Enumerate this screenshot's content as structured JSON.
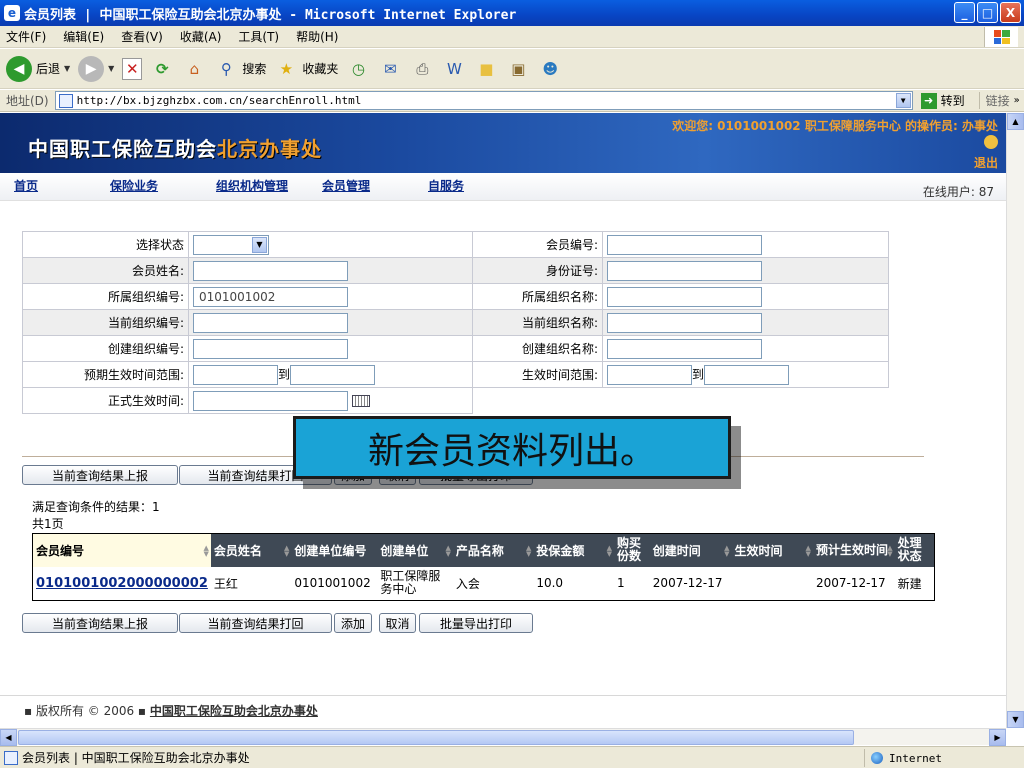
{
  "window": {
    "title": "会员列表 | 中国职工保险互助会北京办事处 - Microsoft Internet Explorer",
    "minimize": "_",
    "maximize": "□",
    "close": "X"
  },
  "menu": [
    "文件(F)",
    "编辑(E)",
    "查看(V)",
    "收藏(A)",
    "工具(T)",
    "帮助(H)"
  ],
  "toolbar": {
    "back": "后退",
    "search": "搜索",
    "favorites": "收藏夹"
  },
  "address": {
    "label": "地址(D)",
    "url": "http://bx.bjzghzbx.com.cn/searchEnroll.html",
    "go": "转到",
    "links": "链接"
  },
  "banner": {
    "logo_main": "中国职工保险互助会",
    "logo_sub": "北京办事处",
    "welcome": "欢迎您: 0101001002 职工保障服务中心 的操作员: 办事处",
    "logout": "退出"
  },
  "nav": {
    "items": [
      "首页",
      "保险业务",
      "组织机构管理",
      "会员管理",
      "自服务"
    ],
    "online": "在线用户: 87"
  },
  "form": {
    "status_label": "选择状态",
    "member_no_label": "会员编号:",
    "member_name_label": "会员姓名:",
    "id_card_label": "身份证号:",
    "org_no_label": "所属组织编号:",
    "org_no_value": "0101001002",
    "org_name_label": "所属组织名称:",
    "cur_org_no_label": "当前组织编号:",
    "cur_org_name_label": "当前组织名称:",
    "create_org_no_label": "创建组织编号:",
    "create_org_name_label": "创建组织名称:",
    "expect_range_label": "预期生效时间范围:",
    "to": "到",
    "effect_range_label": "生效时间范围:",
    "formal_time_label": "正式生效时间:"
  },
  "overlay": "新会员资料列出。",
  "buttons": {
    "report": "当前查询结果上报",
    "return": "当前查询结果打回",
    "add": "添加",
    "cancel": "取消",
    "batch_export": "批量导出打印"
  },
  "result": {
    "matched": "满足查询条件的结果：1",
    "pages": "共1页"
  },
  "grid": {
    "headers": [
      "会员编号",
      "会员姓名",
      "创建单位编号",
      "创建单位",
      "产品名称",
      "投保金额",
      "购买份数",
      "创建时间",
      "生效时间",
      "预计生效时间",
      "处理状态"
    ],
    "rows": [
      [
        "0101001002000000002",
        "王红",
        "0101001002",
        "职工保障服务中心",
        "入会",
        "10.0",
        "1",
        "2007-12-17",
        "",
        "2007-12-17",
        "新建"
      ]
    ]
  },
  "footer": {
    "copyright": "▪ 版权所有 © 2006 ▪",
    "org": "中国职工保险互助会北京办事处"
  },
  "status": {
    "text": "会员列表 | 中国职工保险互助会北京办事处",
    "zone": "Internet"
  }
}
